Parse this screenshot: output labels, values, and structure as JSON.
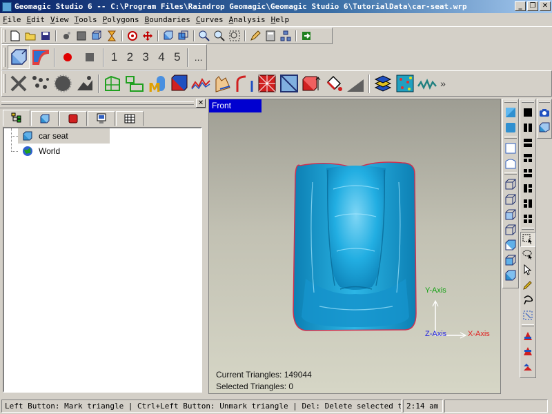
{
  "window": {
    "title": "Geomagic Studio 6 -- C:\\Program Files\\Raindrop Geomagic\\Geomagic Studio 6\\TutorialData\\car-seat.wrp",
    "minimize": "_",
    "restore": "❐",
    "close": "✕"
  },
  "menu": [
    "File",
    "Edit",
    "View",
    "Tools",
    "Polygons",
    "Boundaries",
    "Curves",
    "Analysis",
    "Help"
  ],
  "toolbar2": {
    "numbers": [
      "1",
      "2",
      "3",
      "4",
      "5"
    ],
    "more": "..."
  },
  "toolbar3": {
    "more": "»"
  },
  "leftpanel": {
    "close": "✕",
    "tree": [
      {
        "label": "car seat",
        "icon": "cube-icon"
      },
      {
        "label": "World",
        "icon": "globe-icon"
      }
    ]
  },
  "viewport": {
    "view_name": "Front",
    "axes": {
      "y": "Y-Axis",
      "z": "Z-Axis",
      "x": "X-Axis"
    },
    "current_triangles": "Current Triangles: 149044",
    "selected_triangles": "Selected Triangles: 0",
    "colors": {
      "mesh": "#1aa3d8",
      "mesh_outline": "#d03050",
      "x_axis": "#e02020",
      "y_axis": "#10a010",
      "z_axis": "#2020e0"
    }
  },
  "statusbar": {
    "hint": "Left Button: Mark triangle | Ctrl+Left Button: Unmark triangle | Del: Delete selected triangle(s",
    "time": "2:14 am",
    "extra": ""
  }
}
